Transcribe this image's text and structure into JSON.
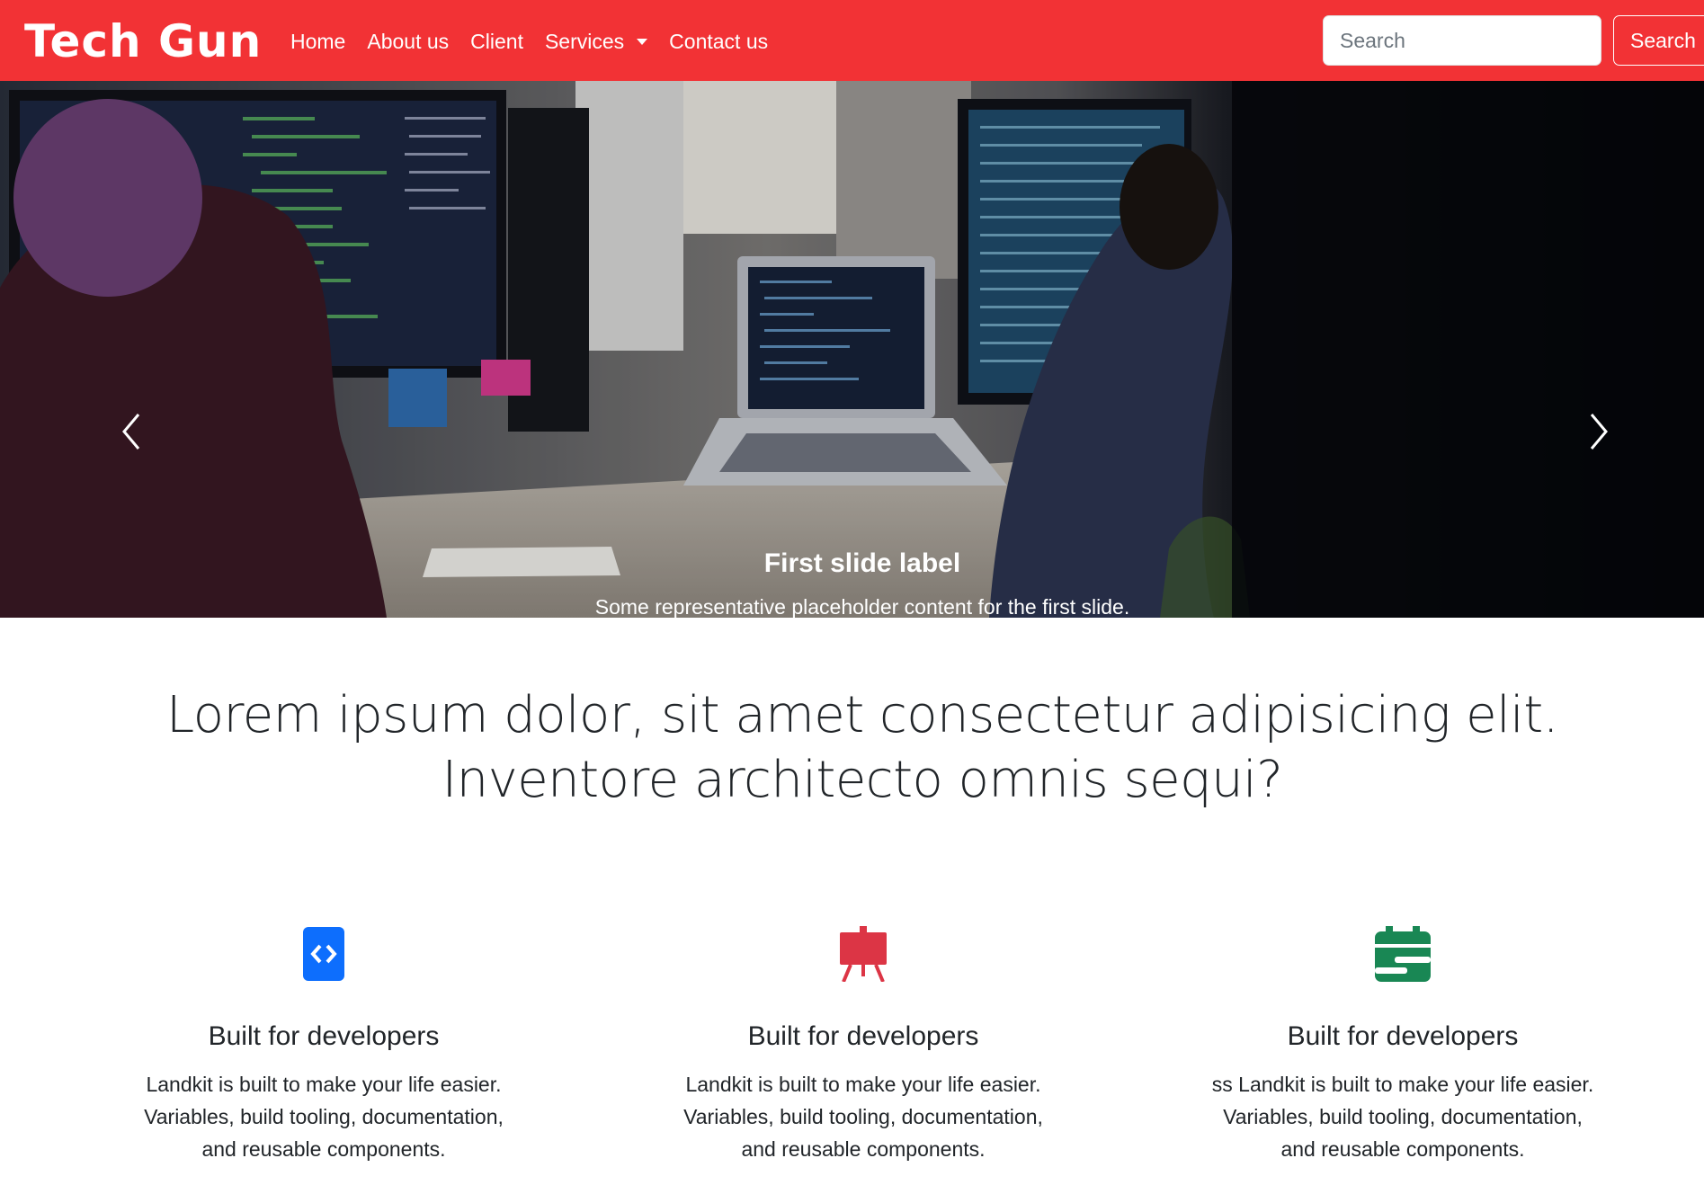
{
  "navbar": {
    "brand": "Tech Gun",
    "links": [
      "Home",
      "About us",
      "Client",
      "Services",
      "Contact us"
    ],
    "search_placeholder": "Search",
    "search_button": "Search",
    "background_color": "#f23235"
  },
  "carousel": {
    "caption_title": "First slide label",
    "caption_text": "Some representative placeholder content for the first slide.",
    "slide_count": 3,
    "active_slide": 1
  },
  "lead": {
    "line1": "Lorem ipsum dolor, sit amet consectetur adipisicing elit.",
    "line2": "Inventore architecto omnis sequi?"
  },
  "features": [
    {
      "icon": "code-icon",
      "color": "#0d6efd",
      "title": "Built for developers",
      "lines": [
        "Landkit is built to make your life easier.",
        "Variables, build tooling, documentation,",
        "and reusable components."
      ]
    },
    {
      "icon": "easel-icon",
      "color": "#dc3545",
      "title": "Built for developers",
      "lines": [
        "Landkit is built to make your life easier.",
        "Variables, build tooling, documentation,",
        "and reusable components."
      ]
    },
    {
      "icon": "calendar-icon",
      "color": "#198754",
      "title": "Built for developers",
      "lines": [
        "ss Landkit is built to make your life easier.",
        "Variables, build tooling, documentation,",
        "and reusable components."
      ]
    }
  ]
}
